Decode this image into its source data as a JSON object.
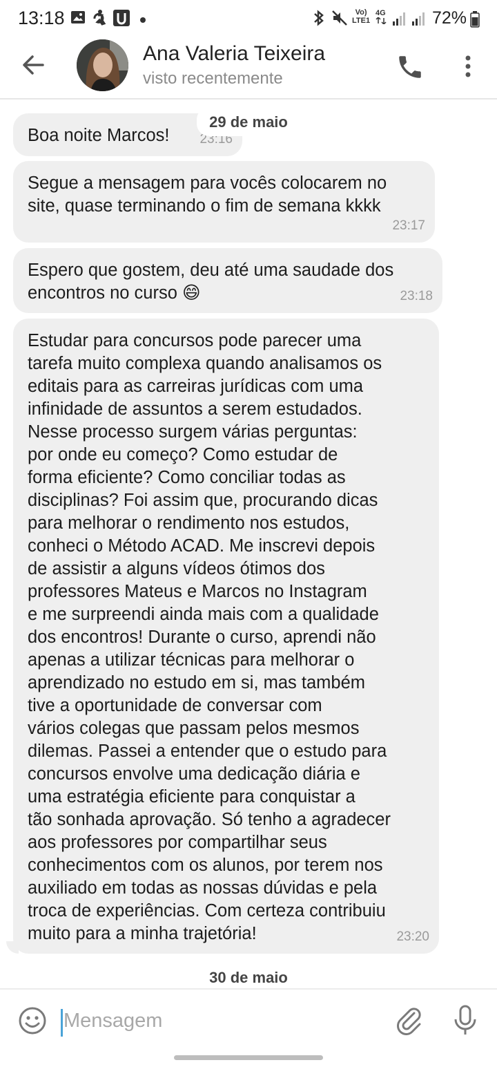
{
  "status_bar": {
    "time": "13:18",
    "battery": "72%",
    "icons": [
      "gallery-icon",
      "accessibility-icon",
      "app-icon",
      "dot-icon",
      "bluetooth-icon",
      "mute-icon",
      "volte-icon",
      "4g-icon",
      "signal-icon",
      "signal-icon",
      "battery-icon"
    ],
    "volte_label_top": "Vo)",
    "volte_label_bottom": "LTE1",
    "net_label": "4G"
  },
  "header": {
    "contact_name": "Ana Valeria Teixeira",
    "status": "visto recentemente",
    "icons": [
      "back-arrow-icon",
      "phone-icon",
      "more-vert-icon"
    ]
  },
  "chat": {
    "date_dividers": [
      "29 de maio",
      "30 de maio"
    ],
    "messages": [
      {
        "lines": [
          "Boa noite Marcos!"
        ],
        "time": "23:16"
      },
      {
        "lines": [
          "Segue a mensagem para vocês colocarem no",
          "site, quase terminando o fim de semana kkkk"
        ],
        "time": "23:17"
      },
      {
        "lines": [
          "Espero que gostem, deu até uma saudade dos",
          "encontros no curso 😄"
        ],
        "time": "23:18"
      },
      {
        "lines": [
          "Estudar para concursos pode parecer uma",
          "tarefa muito complexa quando analisamos os",
          "editais para as carreiras jurídicas com uma",
          "infinidade de assuntos a serem estudados.",
          "Nesse processo surgem várias perguntas:",
          "por onde eu começo? Como estudar de",
          "forma eficiente? Como conciliar todas as",
          "disciplinas? Foi assim que, procurando dicas",
          "para melhorar o rendimento nos estudos,",
          "conheci o Método ACAD. Me inscrevi depois",
          "de assistir a alguns vídeos ótimos dos",
          "professores Mateus e Marcos no Instagram",
          "e me surpreendi ainda mais com a qualidade",
          "dos encontros! Durante o curso, aprendi não",
          "apenas a utilizar técnicas para melhorar o",
          "aprendizado no estudo em si, mas também",
          "tive a oportunidade de conversar com",
          "vários colegas que passam pelos mesmos",
          "dilemas. Passei a entender que o estudo para",
          "concursos envolve uma dedicação diária e",
          "uma estratégia eficiente para conquistar a",
          "tão sonhada aprovação. Só tenho a agradecer",
          "aos professores por compartilhar seus",
          "conhecimentos com os alunos, por terem nos",
          "auxiliado em todas as nossas dúvidas e pela",
          "troca de experiências. Com certeza contribuiu",
          "muito para a minha trajetória!"
        ],
        "time": "23:20"
      }
    ]
  },
  "input": {
    "placeholder": "Mensagem",
    "value": "",
    "icons": [
      "emoji-icon",
      "attach-icon",
      "mic-icon"
    ]
  },
  "colors": {
    "bubble": "#efefef",
    "cursor": "#4aa3d8",
    "icon_gray": "#757575"
  }
}
